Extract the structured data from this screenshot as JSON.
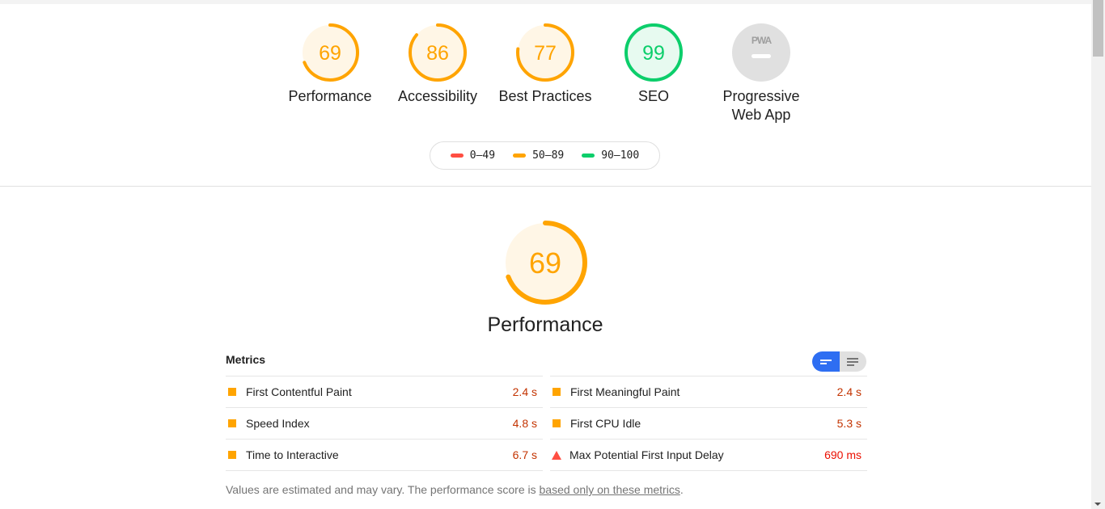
{
  "summary": {
    "gauges": [
      {
        "label": "Performance",
        "score": "69",
        "fraction": 0.69,
        "status": "average"
      },
      {
        "label": "Accessibility",
        "score": "86",
        "fraction": 0.86,
        "status": "average"
      },
      {
        "label": "Best Practices",
        "score": "77",
        "fraction": 0.77,
        "status": "average"
      },
      {
        "label": "SEO",
        "score": "99",
        "fraction": 0.99,
        "status": "pass"
      },
      {
        "label": "Progressive Web App",
        "score": "PWA",
        "fraction": null,
        "status": "na"
      }
    ],
    "legend": [
      {
        "label": "0–49",
        "color": "#ff4e42"
      },
      {
        "label": "50–89",
        "color": "#ffa400"
      },
      {
        "label": "90–100",
        "color": "#0cce6b"
      }
    ]
  },
  "colors": {
    "average": "#ffa400",
    "average_bg": "#fff6e6",
    "pass": "#0cce6b",
    "pass_bg": "#e7faf0",
    "fail": "#ff4e42",
    "na_bg": "#e0e0e0",
    "toggle_active": "#2e6ef2"
  },
  "performance": {
    "score": "69",
    "fraction": 0.69,
    "title": "Performance",
    "metrics_header": "Metrics",
    "metrics_left": [
      {
        "name": "First Contentful Paint",
        "value": "2.4 s",
        "status": "average"
      },
      {
        "name": "Speed Index",
        "value": "4.8 s",
        "status": "average"
      },
      {
        "name": "Time to Interactive",
        "value": "6.7 s",
        "status": "average"
      }
    ],
    "metrics_right": [
      {
        "name": "First Meaningful Paint",
        "value": "2.4 s",
        "status": "average"
      },
      {
        "name": "First CPU Idle",
        "value": "5.3 s",
        "status": "average"
      },
      {
        "name": "Max Potential First Input Delay",
        "value": "690 ms",
        "status": "fail"
      }
    ],
    "footnote_text": "Values are estimated and may vary. The performance score is ",
    "footnote_link": "based only on these metrics",
    "footnote_end": "."
  }
}
